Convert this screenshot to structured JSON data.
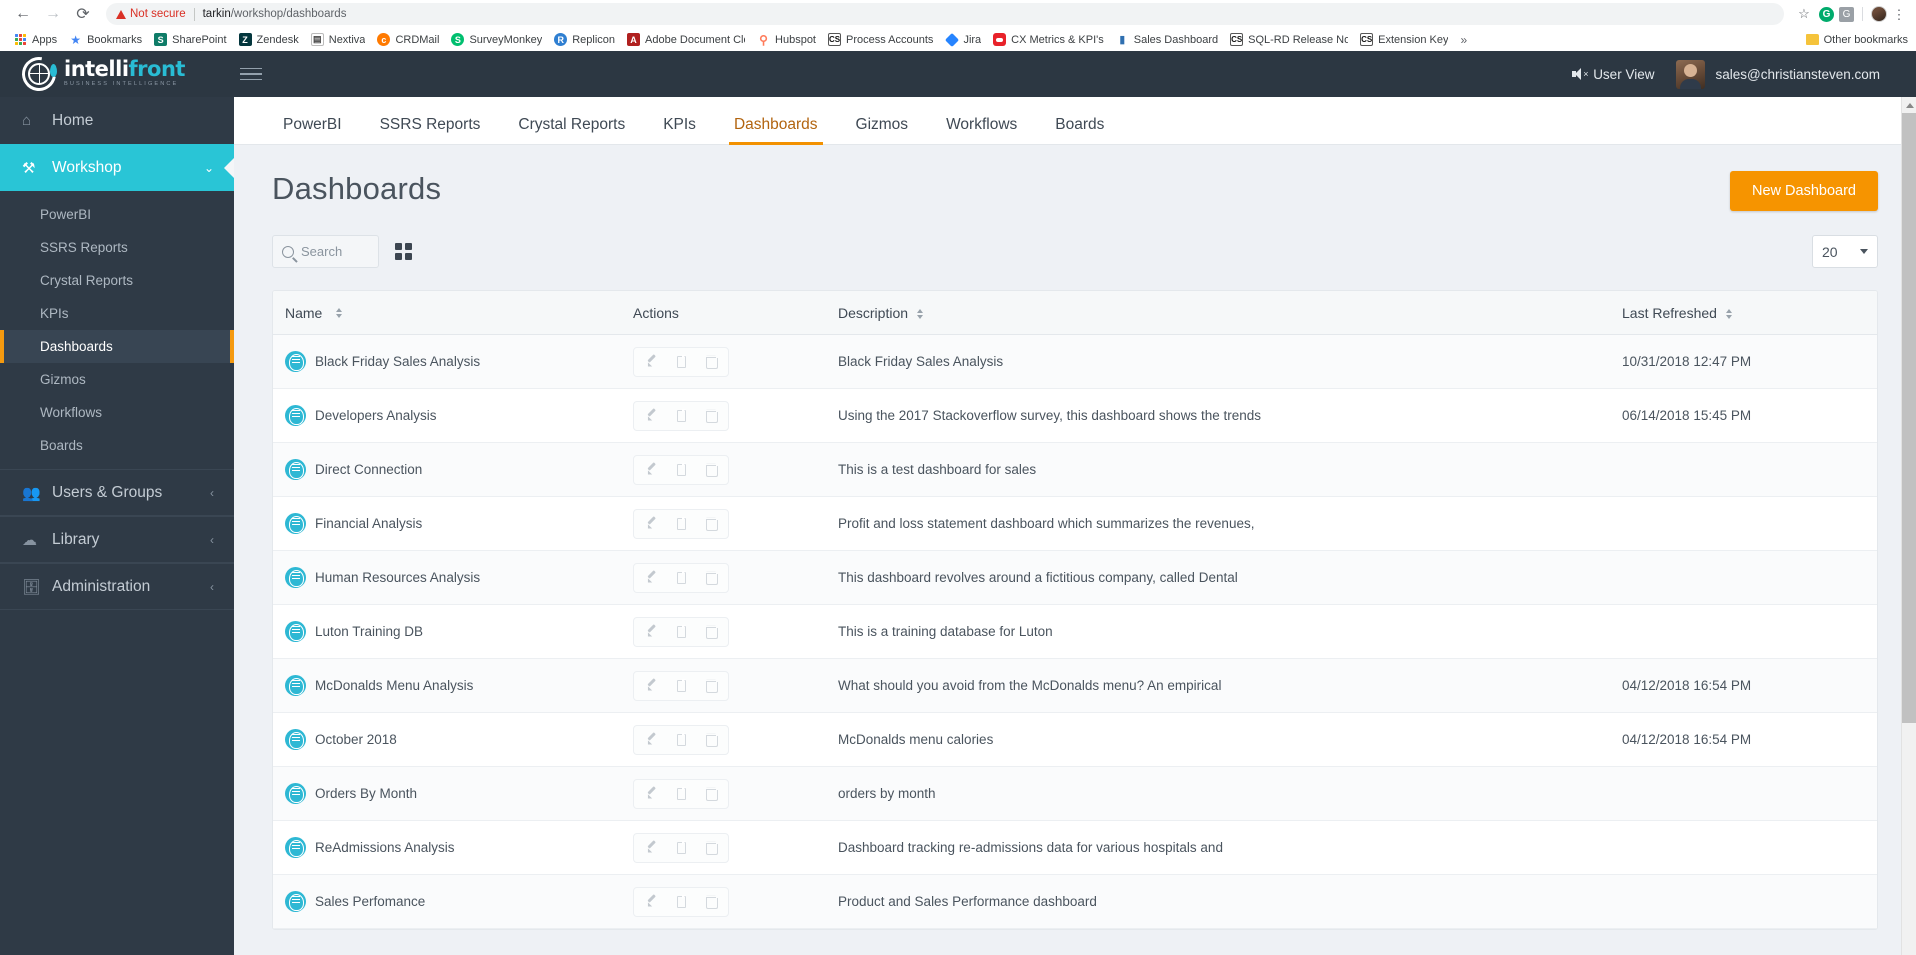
{
  "browser": {
    "back_icon": "←",
    "forward_icon": "→",
    "reload_icon": "⟳",
    "security_label": "Not secure",
    "url_host": "tarkin",
    "url_path": "/workshop/dashboards",
    "star_icon": "☆",
    "grammarly_badge": "G",
    "google_badge": "G",
    "menu_icon": "⋮",
    "bookmarks": [
      {
        "label": "Apps",
        "icon": "apps-grid-icon"
      },
      {
        "label": "Bookmarks",
        "icon": "star-icon"
      },
      {
        "label": "SharePoint",
        "icon": "sharepoint-icon",
        "badge": "S"
      },
      {
        "label": "Zendesk",
        "icon": "zendesk-icon",
        "badge": "Z"
      },
      {
        "label": "Nextiva",
        "icon": "nextiva-icon",
        "badge": "N"
      },
      {
        "label": "CRDMail",
        "icon": "crdmail-icon",
        "badge": "c"
      },
      {
        "label": "SurveyMonkey",
        "icon": "surveymonkey-icon",
        "badge": "S"
      },
      {
        "label": "Replicon",
        "icon": "replicon-icon",
        "badge": "R"
      },
      {
        "label": "Adobe Document Clo",
        "icon": "adobe-icon",
        "badge": "A"
      },
      {
        "label": "Hubspot",
        "icon": "hubspot-icon",
        "badge": "h"
      },
      {
        "label": "Process Accounts",
        "icon": "cs-icon",
        "badge": "CS"
      },
      {
        "label": "Jira",
        "icon": "jira-icon",
        "badge": ""
      },
      {
        "label": "CX Metrics & KPI's",
        "icon": "cx-icon",
        "badge": ""
      },
      {
        "label": "Sales Dashboard",
        "icon": "bar-chart-icon",
        "badge": "▮▮"
      },
      {
        "label": "SQL-RD Release Note",
        "icon": "cs-icon",
        "badge": "CS"
      },
      {
        "label": "Extension Key",
        "icon": "cs-icon",
        "badge": "CS"
      }
    ],
    "overflow_icon": "»",
    "other_bookmarks_label": "Other bookmarks"
  },
  "app_header": {
    "logo_main_a": "intelli",
    "logo_main_b": "front",
    "logo_sub": "BUSINESS INTELLIGENCE",
    "hamburger_icon": "menu-icon",
    "user_view_label": "User View",
    "user_email": "sales@christiansteven.com"
  },
  "sidebar": {
    "items": [
      {
        "label": "Home",
        "icon": "home-icon",
        "state": "normal"
      },
      {
        "label": "Workshop",
        "icon": "wrench-icon",
        "state": "active",
        "chevron": "⌄"
      }
    ],
    "sub_items": [
      {
        "label": "PowerBI",
        "selected": false
      },
      {
        "label": "SSRS Reports",
        "selected": false
      },
      {
        "label": "Crystal Reports",
        "selected": false
      },
      {
        "label": "KPIs",
        "selected": false
      },
      {
        "label": "Dashboards",
        "selected": true
      },
      {
        "label": "Gizmos",
        "selected": false
      },
      {
        "label": "Workflows",
        "selected": false
      },
      {
        "label": "Boards",
        "selected": false
      }
    ],
    "bottom_items": [
      {
        "label": "Users & Groups",
        "icon": "users-icon",
        "chevron": "‹"
      },
      {
        "label": "Library",
        "icon": "cloud-icon",
        "chevron": "‹"
      },
      {
        "label": "Administration",
        "icon": "briefcase-icon",
        "chevron": "‹"
      }
    ]
  },
  "tabs": [
    {
      "label": "PowerBI",
      "active": false
    },
    {
      "label": "SSRS Reports",
      "active": false
    },
    {
      "label": "Crystal Reports",
      "active": false
    },
    {
      "label": "KPIs",
      "active": false
    },
    {
      "label": "Dashboards",
      "active": true
    },
    {
      "label": "Gizmos",
      "active": false
    },
    {
      "label": "Workflows",
      "active": false
    },
    {
      "label": "Boards",
      "active": false
    }
  ],
  "page": {
    "title": "Dashboards",
    "new_button": "New Dashboard",
    "search_placeholder": "Search",
    "search_value": "",
    "grid_toggle_icon": "grid-view-icon",
    "page_size_value": "20"
  },
  "table": {
    "columns": [
      {
        "key": "name",
        "label": "Name",
        "sortable": true
      },
      {
        "key": "actions",
        "label": "Actions",
        "sortable": false
      },
      {
        "key": "description",
        "label": "Description",
        "sortable": true
      },
      {
        "key": "last_refreshed",
        "label": "Last Refreshed",
        "sortable": true
      }
    ],
    "action_icons": [
      "edit-pencil-icon",
      "copy-file-icon",
      "delete-trash-icon"
    ],
    "rows": [
      {
        "name": "Black Friday Sales Analysis",
        "description": "Black Friday Sales Analysis",
        "last_refreshed": "10/31/2018 12:47 PM"
      },
      {
        "name": "Developers Analysis",
        "description": "Using the 2017 Stackoverflow survey, this dashboard shows the trends",
        "last_refreshed": "06/14/2018 15:45 PM"
      },
      {
        "name": "Direct Connection",
        "description": "This is a test dashboard for sales",
        "last_refreshed": ""
      },
      {
        "name": "Financial Analysis",
        "description": "Profit and loss statement dashboard which summarizes the revenues,",
        "last_refreshed": ""
      },
      {
        "name": "Human Resources Analysis",
        "description": "This dashboard revolves around a fictitious company, called Dental",
        "last_refreshed": ""
      },
      {
        "name": "Luton Training DB",
        "description": "This is a training database for Luton",
        "last_refreshed": ""
      },
      {
        "name": "McDonalds Menu Analysis",
        "description": "What should you avoid from the McDonalds menu? An empirical",
        "last_refreshed": "04/12/2018 16:54 PM"
      },
      {
        "name": "October 2018",
        "description": "McDonalds menu calories",
        "last_refreshed": "04/12/2018 16:54 PM"
      },
      {
        "name": "Orders By Month",
        "description": "orders by month",
        "last_refreshed": ""
      },
      {
        "name": "ReAdmissions Analysis",
        "description": "Dashboard tracking re-admissions data for various hospitals and",
        "last_refreshed": ""
      },
      {
        "name": "Sales Perfomance",
        "description": "Product and Sales Performance dashboard",
        "last_refreshed": ""
      }
    ]
  },
  "colors": {
    "accent_orange": "#f69400",
    "accent_teal": "#29c5d6",
    "header_dark": "#2c3742",
    "sidebar_dark": "#2f3a46"
  }
}
